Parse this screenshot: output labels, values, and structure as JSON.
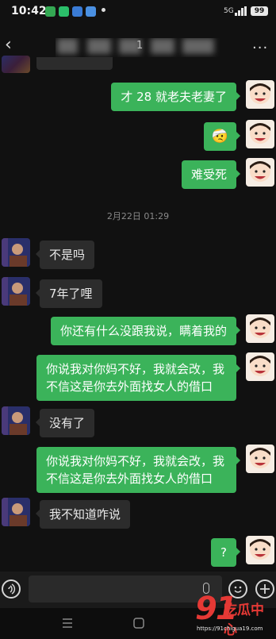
{
  "status_bar": {
    "time": "10:42",
    "signal": "5G",
    "battery": "99"
  },
  "header": {
    "title_fragment": "1"
  },
  "messages": [
    {
      "from": "me",
      "text": "才 28 就老夫老妻了"
    },
    {
      "from": "me",
      "emoji": "🤕"
    },
    {
      "from": "me",
      "text": "难受死"
    },
    {
      "from": "other",
      "text": "不是吗"
    },
    {
      "from": "other",
      "text": "7年了哩"
    },
    {
      "from": "me",
      "text": "你还有什么没跟我说，瞒着我的"
    },
    {
      "from": "me",
      "text": "你说我对你妈不好，我就会改，我不信这是你去外面找女人的借口"
    },
    {
      "from": "other",
      "text": "没有了"
    },
    {
      "from": "me",
      "text": "你说我对你妈不好，我就会改，我不信这是你去外面找女人的借口"
    },
    {
      "from": "other",
      "text": "我不知道咋说"
    },
    {
      "from": "me",
      "text": "?"
    }
  ],
  "timestamp": "2月22日 01:29",
  "watermark": {
    "number": "91",
    "label": "吃瓜中心",
    "url": "https://91chigua19.com"
  },
  "icons": [
    "back-icon",
    "more-icon",
    "voice-icon",
    "emoji-icon",
    "plus-icon",
    "menu-icon",
    "home-icon"
  ]
}
